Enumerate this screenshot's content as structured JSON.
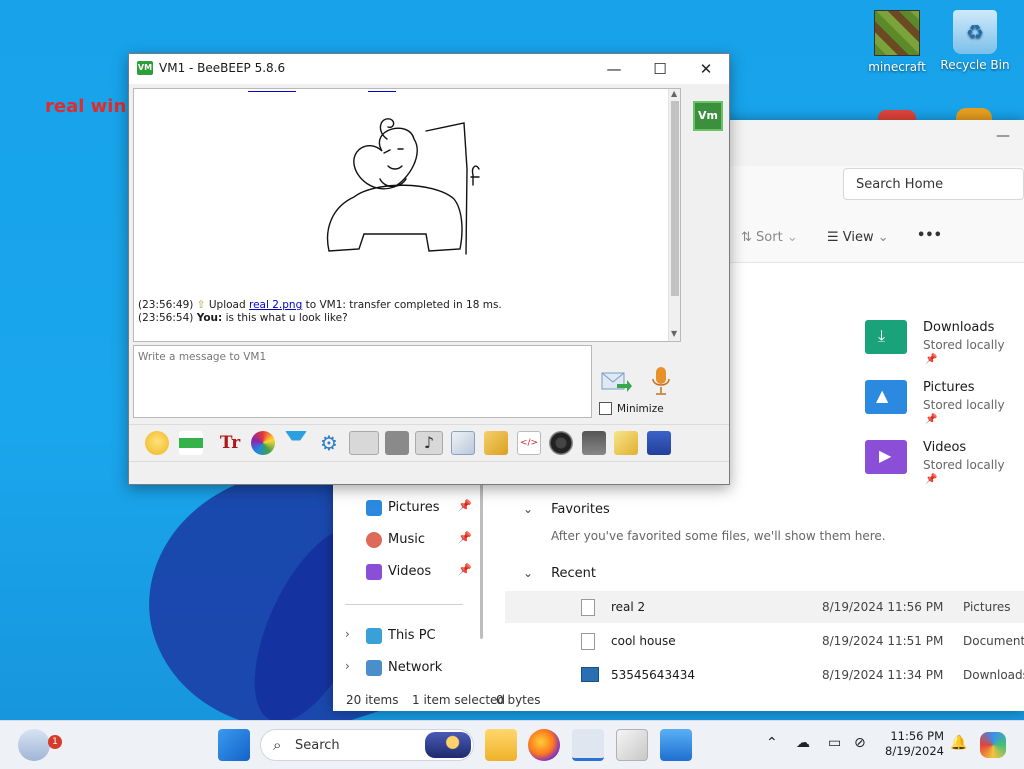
{
  "desktop": {
    "overlay_text": "real win",
    "icons": [
      {
        "label": "minecraft",
        "icon": "minecraft-shortcut-icon"
      },
      {
        "label": "Recycle Bin",
        "icon": "recycle-bin-icon"
      }
    ]
  },
  "beebeep": {
    "title": "VM1 - BeeBEEP 5.8.6",
    "avatar_text": "Vm",
    "messages": [
      {
        "time": "(23:56:49)",
        "pre": "Upload ",
        "link": "real 2.png",
        "post": " to VM1: transfer completed in 18 ms."
      },
      {
        "time": "(23:56:54)",
        "sender": "You:",
        "text": " is this what u look like?"
      }
    ],
    "input_placeholder": "Write a message to VM1",
    "minimize_label": "Minimize",
    "toolbar_icons": [
      "emoticon-icon",
      "green-arrow-icon",
      "font-icon",
      "color-icon",
      "filter-icon",
      "settings-gear-icon",
      "save-chat-icon",
      "print-icon",
      "sound-icon",
      "send-file-icon",
      "send-folder-icon",
      "html-icon",
      "record-icon",
      "screenshot-icon",
      "notes-icon",
      "save-icon"
    ]
  },
  "explorer": {
    "search_placeholder": "Search Home",
    "sort_label": "Sort",
    "view_label": "View",
    "more_label": "•••",
    "quick_access": [
      {
        "name": "Downloads",
        "sub": "Stored locally",
        "color": "#1aa37a"
      },
      {
        "name": "Pictures",
        "sub": "Stored locally",
        "color": "#2b8ae0"
      },
      {
        "name": "Videos",
        "sub": "Stored locally",
        "color": "#8a4fd6"
      }
    ],
    "nav": [
      {
        "label": "Pictures",
        "icon": "pictures-icon",
        "pinned": true
      },
      {
        "label": "Music",
        "icon": "music-icon",
        "pinned": true
      },
      {
        "label": "Videos",
        "icon": "videos-icon",
        "pinned": true
      },
      {
        "label": "This PC",
        "icon": "this-pc-icon",
        "expandable": true
      },
      {
        "label": "Network",
        "icon": "network-icon",
        "expandable": true
      }
    ],
    "favorites_title": "Favorites",
    "favorites_empty": "After you've favorited some files, we'll show them here.",
    "recent_title": "Recent",
    "recent": [
      {
        "name": "real 2",
        "date": "8/19/2024 11:56 PM",
        "location": "Pictures"
      },
      {
        "name": "cool house",
        "date": "8/19/2024 11:51 PM",
        "location": "Documents"
      },
      {
        "name": "53545643434",
        "date": "8/19/2024 11:34 PM",
        "location": "Downloads"
      }
    ],
    "status": {
      "items": "20 items",
      "selected": "1 item selected",
      "size": "0 bytes"
    }
  },
  "taskbar": {
    "search_label": "Search",
    "weather_badge": "1",
    "time": "11:56 PM",
    "date": "8/19/2024"
  }
}
